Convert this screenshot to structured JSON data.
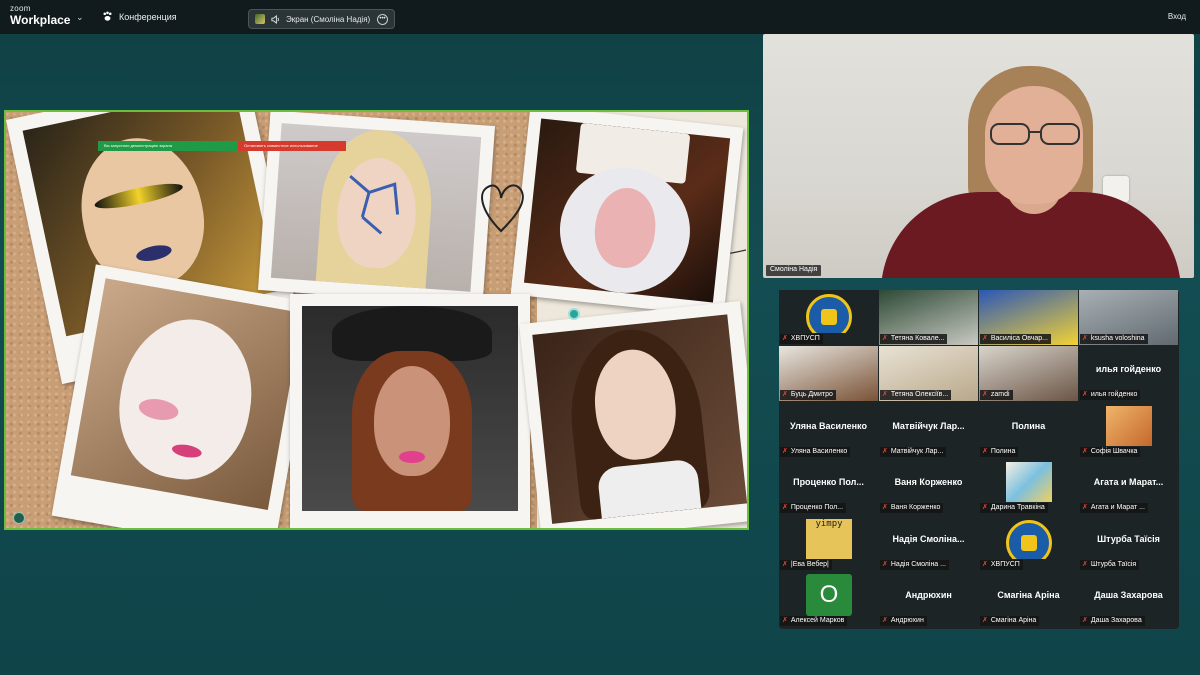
{
  "topbar": {
    "brand_small": "zoom",
    "brand_big": "Workplace",
    "conference_label": "Конференция",
    "screen_label": "Экран (Смоліна Надія)",
    "signin_label": "Вход"
  },
  "shared_screen": {
    "share_notice": "Вы запустили демонстрацию экрана",
    "stop_share": "Остановить совместное использование"
  },
  "speaker": {
    "name": "Смоліна Надія"
  },
  "gallery": [
    {
      "name": "ХВПУСП",
      "kind": "emblem"
    },
    {
      "name": "Тетяна Ковале...",
      "kind": "video",
      "colors": [
        "#2d4a35",
        "#c9c9c2"
      ]
    },
    {
      "name": "Василіса Овчар...",
      "kind": "video",
      "colors": [
        "#2b57b7",
        "#f3d234"
      ]
    },
    {
      "name": "ksusha voloshina",
      "kind": "video",
      "colors": [
        "#a9b0b4",
        "#606a70"
      ]
    },
    {
      "name": "Буць Дмитро",
      "kind": "video",
      "colors": [
        "#e8e6e0",
        "#7a5236"
      ]
    },
    {
      "name": "Тетяна Олексіїв...",
      "kind": "video",
      "colors": [
        "#e8e2d4",
        "#b9a88a"
      ]
    },
    {
      "name": "zamdi",
      "kind": "video",
      "colors": [
        "#d8d4cc",
        "#6b5545"
      ]
    },
    {
      "name": "илья гойденко",
      "kind": "text",
      "big": "илья гойденко"
    },
    {
      "name": "Уляна Василенко",
      "kind": "text",
      "big": "Уляна Василенко"
    },
    {
      "name": "Матвійчук Лар...",
      "kind": "text",
      "big": "Матвійчук Лар..."
    },
    {
      "name": "Полина",
      "kind": "text",
      "big": "Полина"
    },
    {
      "name": "Софія Швачка",
      "kind": "cat"
    },
    {
      "name": "Проценко Пол...",
      "kind": "text",
      "big": "Проценко Пол..."
    },
    {
      "name": "Ваня Корженко",
      "kind": "text",
      "big": "Ваня Корженко"
    },
    {
      "name": "Дарина Травкіна",
      "kind": "cartoon"
    },
    {
      "name": "Агата и Марат ...",
      "kind": "text",
      "big": "Агата и Марат..."
    },
    {
      "name": "|Ева Вебер|",
      "kind": "yimpy",
      "avatar_text": "yimpy"
    },
    {
      "name": "Надія Смоліна ...",
      "kind": "text",
      "big": "Надія Смоліна..."
    },
    {
      "name": "ХВПУСП",
      "kind": "emblem"
    },
    {
      "name": "Штурба Таїсія",
      "kind": "text",
      "big": "Штурба Таїсія"
    },
    {
      "name": "Алексей Марков",
      "kind": "letter",
      "letter": "О"
    },
    {
      "name": "Андрюхин",
      "kind": "text",
      "big": "Андрюхин"
    },
    {
      "name": "Смагіна Аріна",
      "kind": "text",
      "big": "Смагіна Аріна"
    },
    {
      "name": "Даша Захарова",
      "kind": "text",
      "big": "Даша Захарова"
    }
  ],
  "icons": {
    "muted_mic": "muted-mic-icon",
    "paw": "paw-icon",
    "chevron": "chevron-down-icon",
    "more": "more-icon"
  }
}
